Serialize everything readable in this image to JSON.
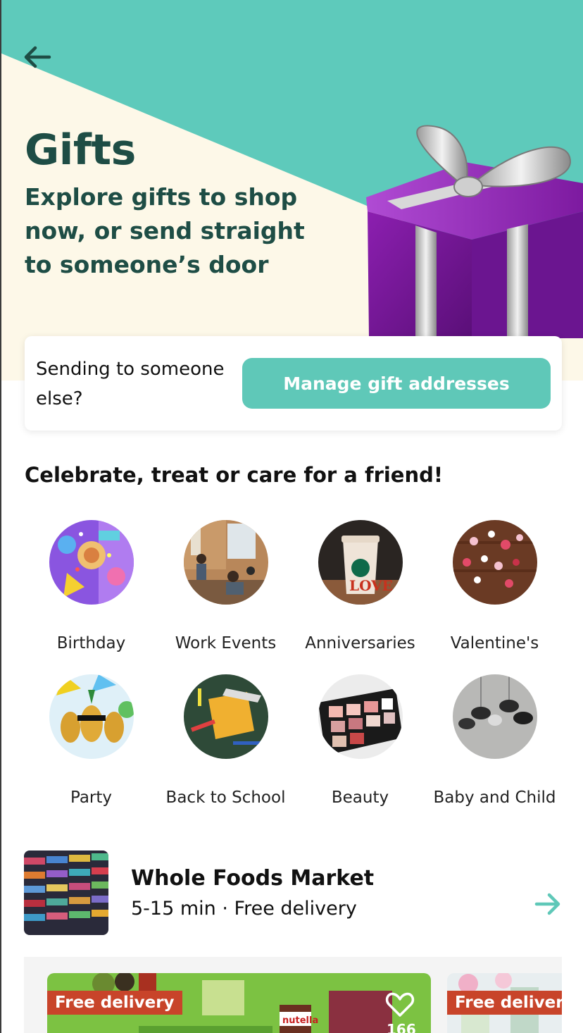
{
  "hero": {
    "title": "Gifts",
    "subtitle": "Explore gifts to shop now, or send straight to someone’s door",
    "back_icon": "arrow-left-icon",
    "colors": {
      "teal": "#5ecabb",
      "cream": "#fdf8e8",
      "title_text": "#1e4d45"
    }
  },
  "send": {
    "prompt": "Sending to someone else?",
    "button_label": "Manage gift addresses",
    "button_color": "#5fc8b8"
  },
  "categories": {
    "title": "Celebrate, treat or care for a friend!",
    "items": [
      {
        "label": "Birthday"
      },
      {
        "label": "Work Events"
      },
      {
        "label": "Anniversaries"
      },
      {
        "label": "Valentine's"
      },
      {
        "label": "Party"
      },
      {
        "label": "Back to School"
      },
      {
        "label": "Beauty"
      },
      {
        "label": "Baby and Child"
      }
    ]
  },
  "store": {
    "name": "Whole Foods Market",
    "meta": "5-15 min · Free delivery",
    "arrow_icon": "arrow-right-icon",
    "accent": "#5fc8b8"
  },
  "carousel": {
    "cards": [
      {
        "badge": "Free delivery",
        "favorite_icon": "heart-outline-icon",
        "count": "166"
      },
      {
        "badge": "Free delivery"
      }
    ]
  }
}
